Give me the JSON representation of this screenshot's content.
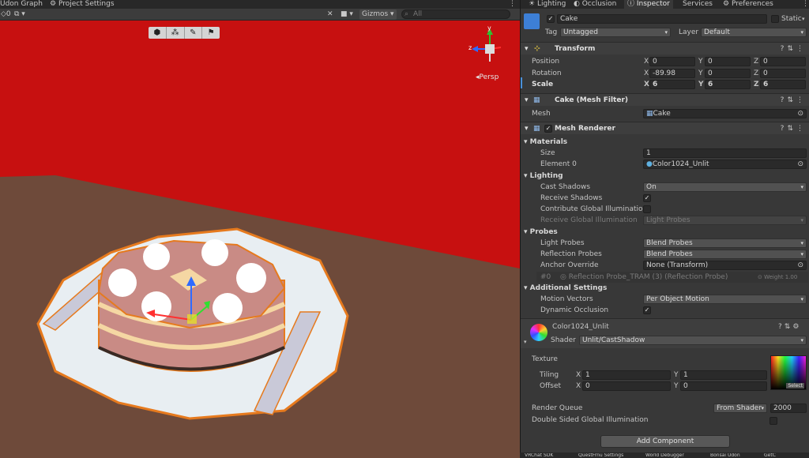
{
  "scene_tabs": {
    "udon_graph": "Udon Graph",
    "project_settings": "Project Settings"
  },
  "scene_toolbar": {
    "layer_count": "0",
    "gizmos": "Gizmos",
    "search_placeholder": "All"
  },
  "gizmo": {
    "y": "y",
    "z": "z",
    "persp": "Persp"
  },
  "insp_tabs": {
    "lighting": "Lighting",
    "occlusion": "Occlusion",
    "inspector": "Inspector",
    "services": "Services",
    "preferences": "Preferences"
  },
  "object": {
    "name": "Cake",
    "static_label": "Static",
    "tag_label": "Tag",
    "tag": "Untagged",
    "layer_label": "Layer",
    "layer": "Default"
  },
  "transform": {
    "title": "Transform",
    "position_label": "Position",
    "rotation_label": "Rotation",
    "scale_label": "Scale",
    "position": {
      "x": "0",
      "y": "0",
      "z": "0"
    },
    "rotation": {
      "x": "-89.98",
      "y": "0",
      "z": "0"
    },
    "scale": {
      "x": "6",
      "y": "6",
      "z": "6"
    },
    "axis": {
      "x": "X",
      "y": "Y",
      "z": "Z"
    }
  },
  "mesh_filter": {
    "title": "Cake (Mesh Filter)",
    "mesh_label": "Mesh",
    "mesh": "Cake"
  },
  "mesh_renderer": {
    "title": "Mesh Renderer",
    "materials": "Materials",
    "size_label": "Size",
    "size": "1",
    "element0_label": "Element 0",
    "element0": "Color1024_Unlit",
    "lighting": "Lighting",
    "cast_shadows_label": "Cast Shadows",
    "cast_shadows": "On",
    "receive_shadows_label": "Receive Shadows",
    "contribute_gi_label": "Contribute Global Illumination",
    "receive_gi_label": "Receive Global Illumination",
    "receive_gi": "Light Probes",
    "probes": "Probes",
    "light_probes_label": "Light Probes",
    "light_probes": "Blend Probes",
    "reflection_probes_label": "Reflection Probes",
    "reflection_probes": "Blend Probes",
    "anchor_override_label": "Anchor Override",
    "anchor_override": "None (Transform)",
    "probe_index": "#0",
    "probe_name": "Reflection Probe_TRAM (3) (Reflection Probe)",
    "probe_weight": "Weight 1.00",
    "additional": "Additional Settings",
    "motion_vectors_label": "Motion Vectors",
    "motion_vectors": "Per Object Motion",
    "dynamic_occlusion_label": "Dynamic Occlusion"
  },
  "material": {
    "name": "Color1024_Unlit",
    "shader_label": "Shader",
    "shader": "Unlit/CastShadow",
    "texture_label": "Texture",
    "select": "Select",
    "tiling_label": "Tiling",
    "offset_label": "Offset",
    "tiling": {
      "x": "1",
      "y": "1"
    },
    "offset": {
      "x": "0",
      "y": "0"
    },
    "render_queue_label": "Render Queue",
    "render_queue_mode": "From Shader",
    "render_queue": "2000",
    "double_sided_label": "Double Sided Global Illumination"
  },
  "add_component": "Add Component",
  "bottom_tabs": [
    "VRChat SDK",
    "QuestFrnu Settings",
    "World Debugger",
    "Bonsai Udon",
    "GetC"
  ],
  "colors": {
    "background": "#c71010",
    "floor": "#6e4a3a",
    "selection": "#e67a1e",
    "cake_side": "#c98b85",
    "cream": "#f5d7a3"
  }
}
